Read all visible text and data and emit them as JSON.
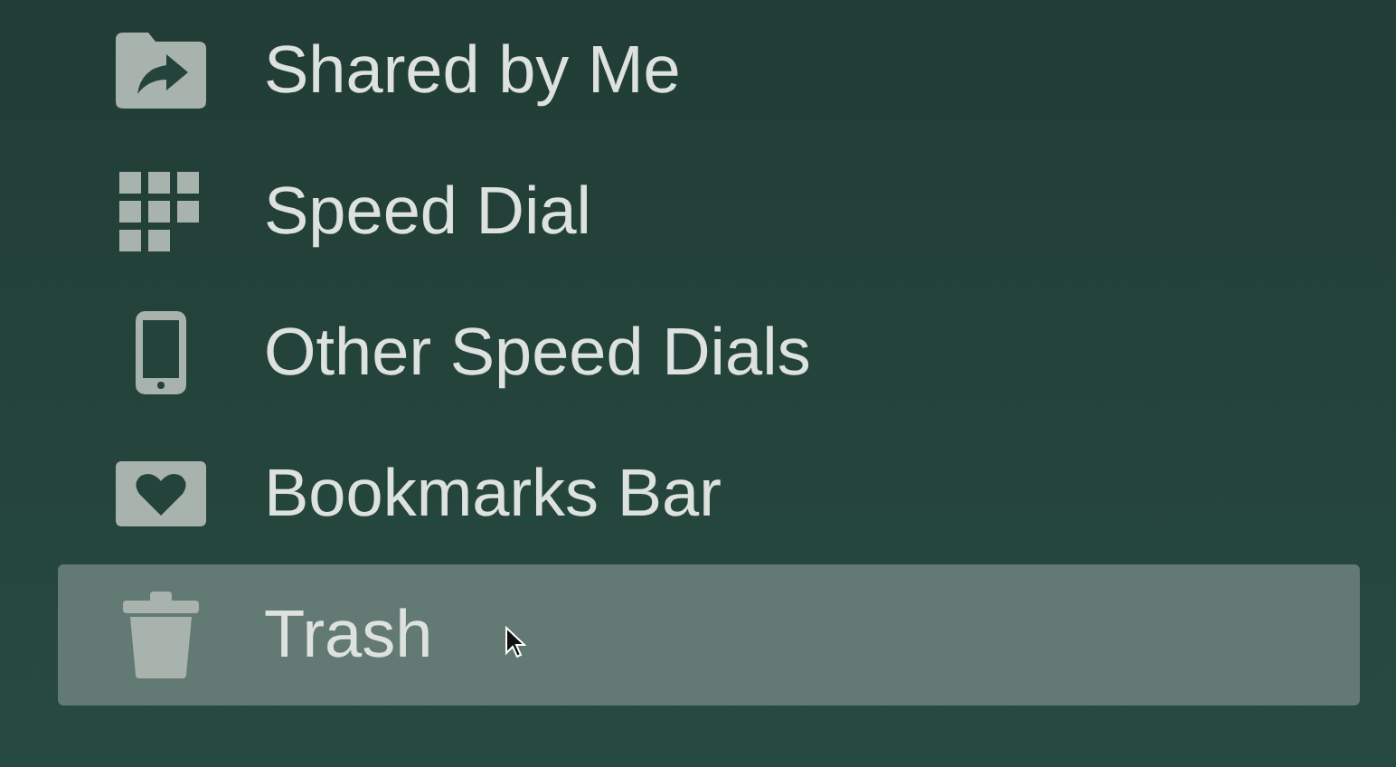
{
  "sidebar": {
    "items": [
      {
        "kind": "shared-folder",
        "label": "Shared by Me",
        "selected": false
      },
      {
        "kind": "grid",
        "label": "Speed Dial",
        "selected": false
      },
      {
        "kind": "phone",
        "label": "Other Speed Dials",
        "selected": false
      },
      {
        "kind": "heart-box",
        "label": "Bookmarks Bar",
        "selected": false
      },
      {
        "kind": "trash",
        "label": "Trash",
        "selected": true
      }
    ]
  }
}
